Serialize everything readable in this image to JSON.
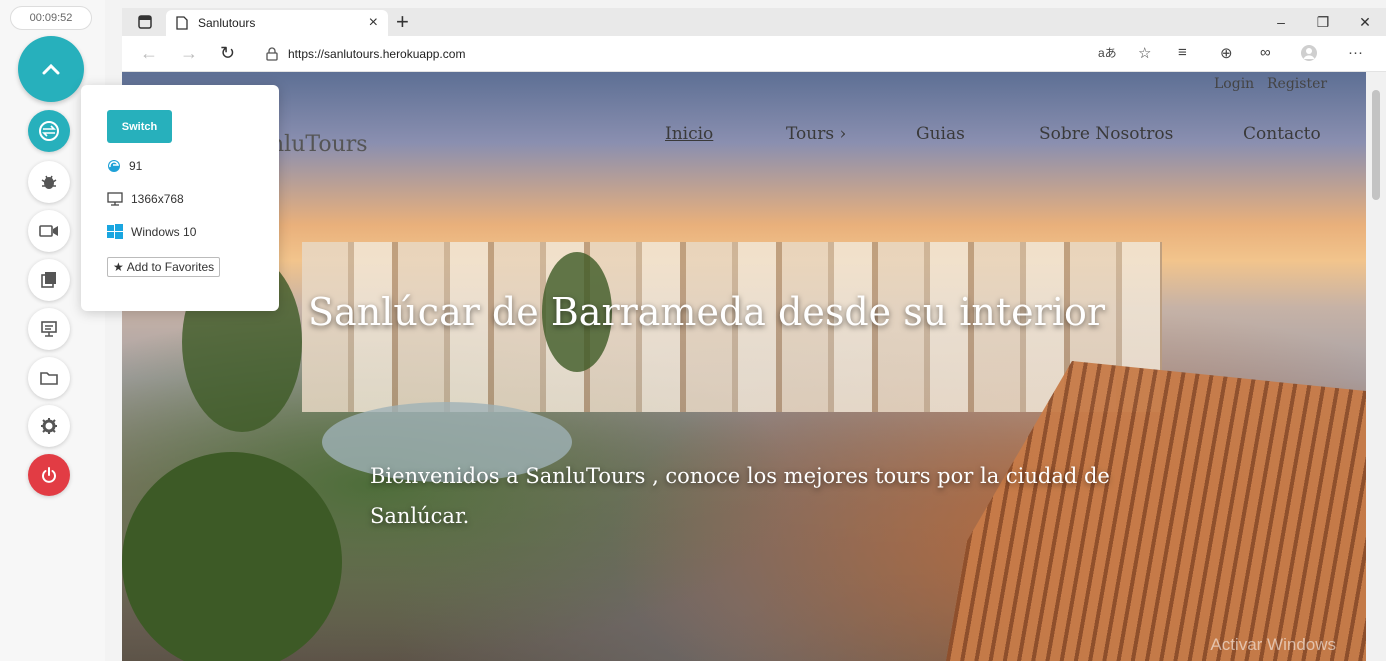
{
  "rail": {
    "timer": "00:09:52",
    "buttons": [
      "switch-icon",
      "bug-icon",
      "video-icon",
      "gallery-icon",
      "display-icon",
      "folder-icon",
      "gear-icon",
      "power-icon"
    ]
  },
  "popup": {
    "switch_label": "Switch",
    "browser_version": "91",
    "resolution": "1366x768",
    "os": "Windows 10",
    "favorites_label": "Add to Favorites"
  },
  "browser": {
    "tab_title": "Sanlutours",
    "url": "https://sanlutours.herokuapp.com"
  },
  "site": {
    "brand": "nluTours",
    "auth": {
      "login": "Login",
      "register": "Register"
    },
    "nav": [
      "Inicio",
      "Tours ›",
      "Guias",
      "Sobre Nosotros",
      "Contacto"
    ],
    "hero_title": "Sanlúcar de Barrameda desde su interior",
    "hero_subtitle": "Bienvenidos a SanluTours , conoce los mejores tours por la ciudad de Sanlúcar.",
    "watermark": "Activar Windows"
  }
}
